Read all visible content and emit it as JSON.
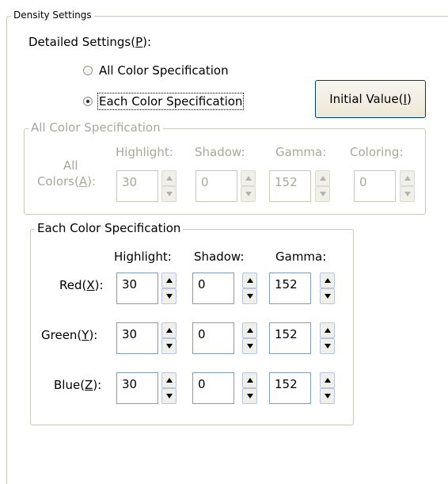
{
  "outer_group": {
    "title": "Density Settings"
  },
  "detailed_settings": {
    "label_prefix": "Detailed Settings(",
    "label_key": "P",
    "label_suffix": "):"
  },
  "radio_all": {
    "label": "All Color Specification",
    "selected": false
  },
  "radio_each": {
    "label": "Each Color Specification",
    "selected": true
  },
  "initial_button": {
    "prefix": "Initial Value(",
    "key": "I",
    "suffix": ")"
  },
  "all_group": {
    "title": "All Color Specification",
    "headers": [
      "Highlight:",
      "Shadow:",
      "Gamma:",
      "Coloring:"
    ],
    "row_label_line1": "All",
    "row_label_prefix": "Colors(",
    "row_label_key": "A",
    "row_label_suffix": "):",
    "values": [
      "30",
      "0",
      "152",
      "0"
    ]
  },
  "each_group": {
    "title": "Each Color Specification",
    "headers": [
      "Highlight:",
      "Shadow:",
      "Gamma:"
    ],
    "rows": [
      {
        "prefix": "Red(",
        "key": "X",
        "suffix": "):",
        "highlight": "30",
        "shadow": "0",
        "gamma": "152"
      },
      {
        "prefix": "Green(",
        "key": "Y",
        "suffix": "):",
        "highlight": "30",
        "shadow": "0",
        "gamma": "152"
      },
      {
        "prefix": "Blue(",
        "key": "Z",
        "suffix": "):",
        "highlight": "30",
        "shadow": "0",
        "gamma": "152"
      }
    ]
  },
  "colors": {
    "disabled_text": "#a9a79c",
    "frame_border": "#c7c7bb",
    "field_border": "#7f9db9"
  }
}
